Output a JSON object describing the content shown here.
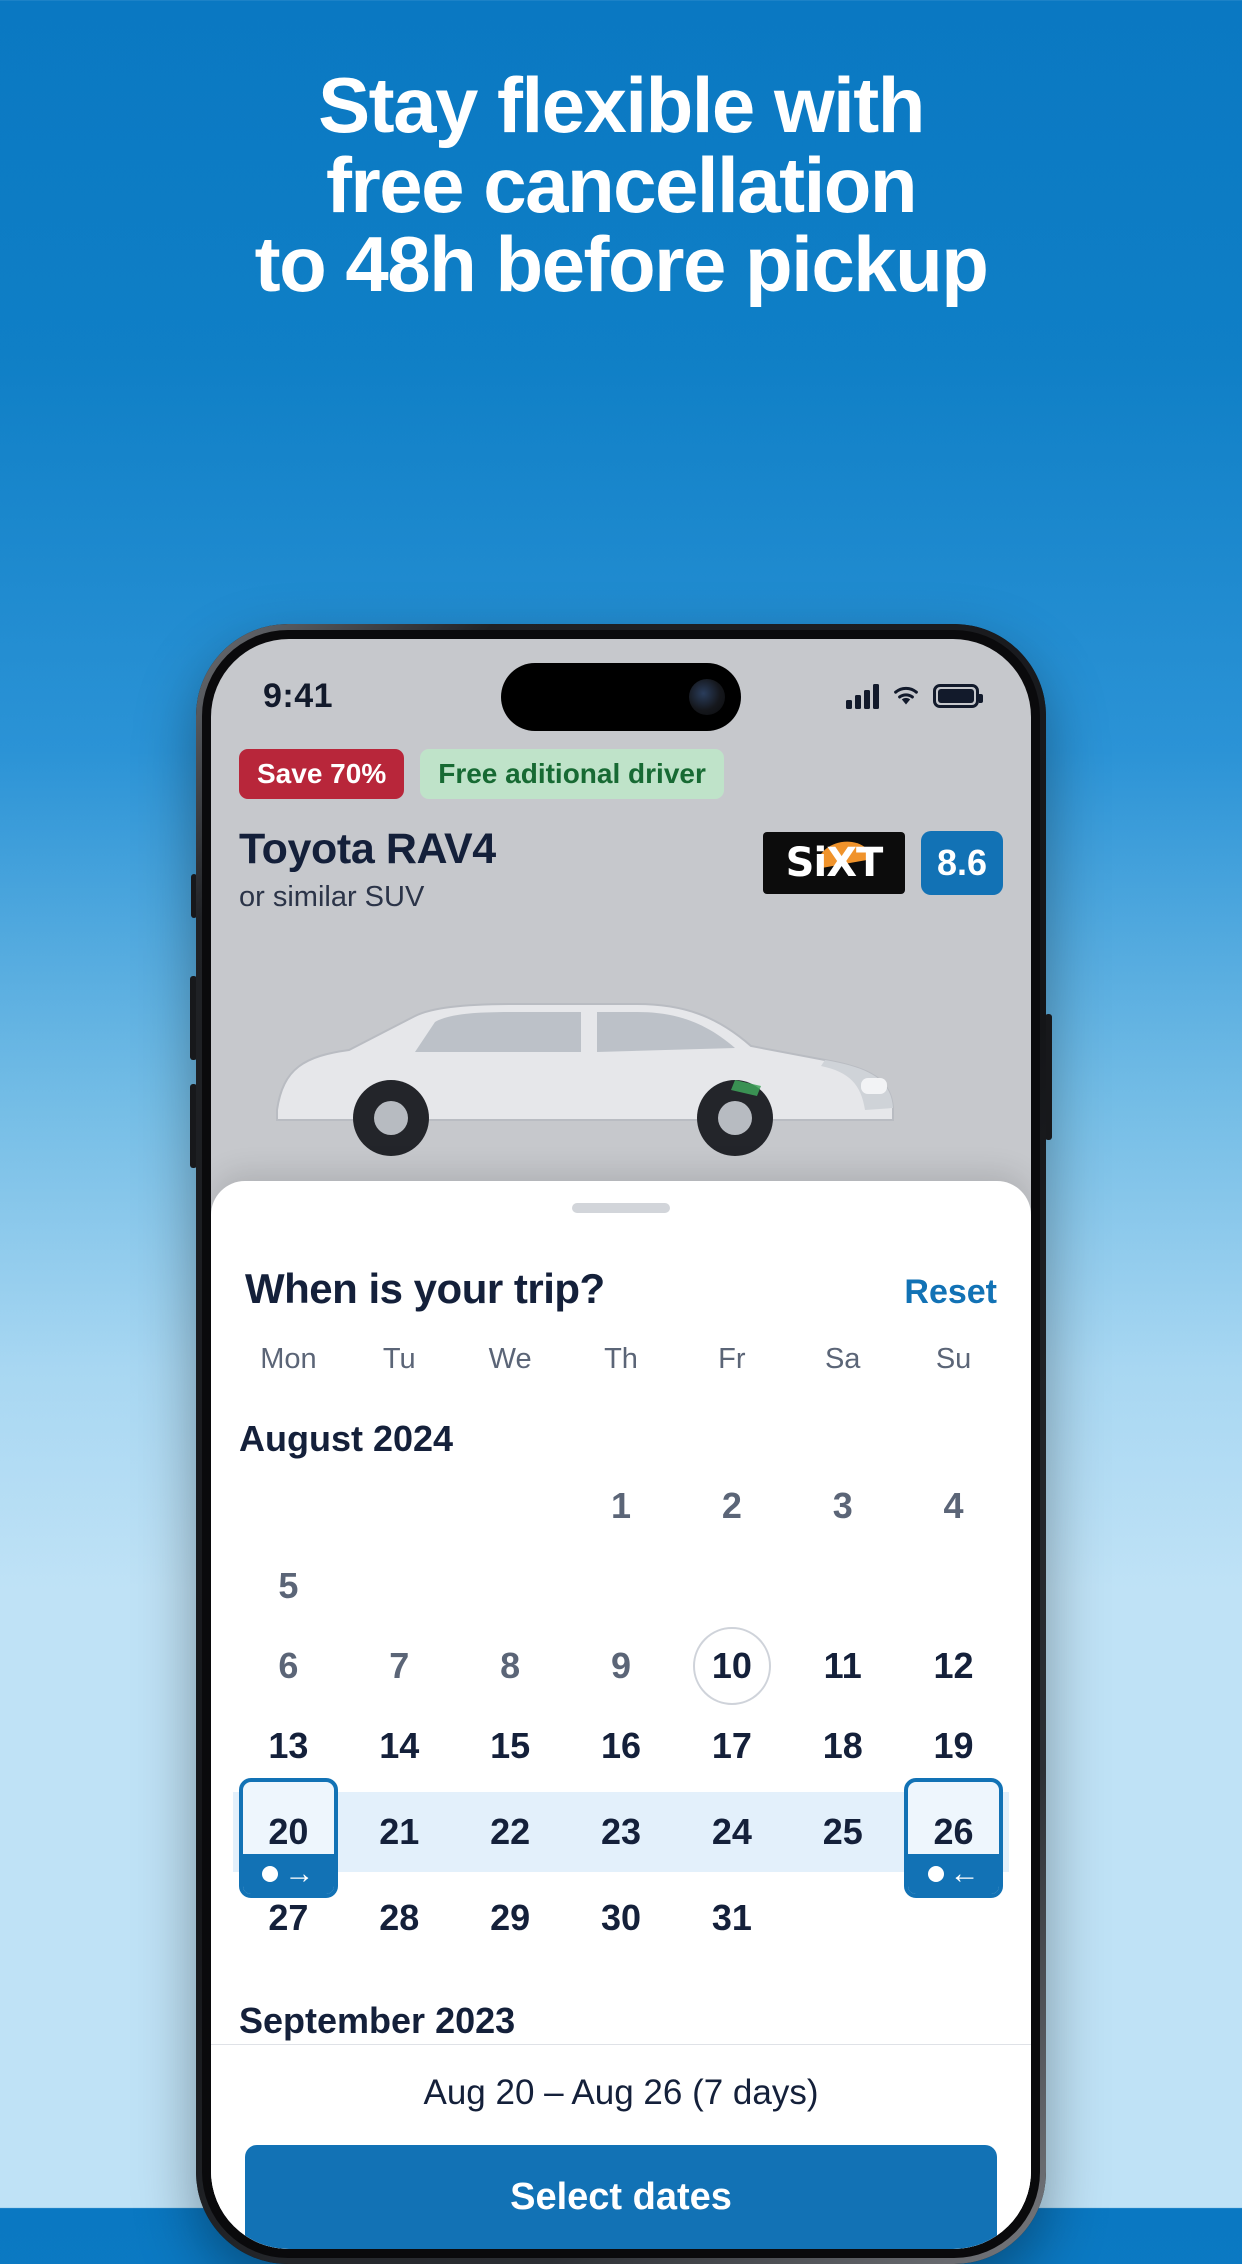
{
  "hero": {
    "headline_lines": [
      "Stay flexible with",
      "free cancellation",
      "to 48h before pickup"
    ],
    "background_top_color": "#0a78c2",
    "background_bottom_color": "#bfe2f6"
  },
  "phone": {
    "status_bar": {
      "time": "9:41",
      "signal_icon": "cellular-bars-icon",
      "wifi_icon": "wifi-icon",
      "battery_icon": "battery-full-icon"
    }
  },
  "car_card": {
    "chips": [
      {
        "label": "Save 70%",
        "style": "discount",
        "color": "#b8263a"
      },
      {
        "label": "Free aditional driver",
        "style": "perk",
        "color": "#bfe3c9"
      }
    ],
    "title": "Toyota RAV4",
    "subtitle": "or similar SUV",
    "supplier_logo_text": "SiXT",
    "rating": "8.6",
    "rating_color": "#1272b5"
  },
  "sheet": {
    "title": "When is your trip?",
    "reset_label": "Reset",
    "weekdays": [
      "Mon",
      "Tu",
      "We",
      "Th",
      "Fr",
      "Sa",
      "Su"
    ],
    "months": [
      {
        "label": "August 2024",
        "weeks": [
          [
            "",
            "",
            "",
            "1",
            "2",
            "3",
            "4"
          ],
          [
            "5",
            "6",
            "7",
            "8",
            "9",
            "10",
            "11"
          ],
          [
            "12",
            "13",
            "14",
            "15",
            "16",
            "17",
            "18"
          ],
          [
            "19",
            "20",
            "21",
            "22",
            "23",
            "24",
            "25"
          ],
          [
            "26",
            "27",
            "28",
            "29",
            "30",
            "31",
            ""
          ]
        ]
      },
      {
        "label": "September 2023",
        "weeks": []
      }
    ],
    "grid_rows": [
      {
        "cells": [
          "",
          "",
          "",
          "1",
          "2",
          "3",
          "4",
          "5"
        ]
      }
    ],
    "displayed_rows": [
      [
        "",
        "",
        "",
        "1",
        "2",
        "3",
        "4",
        "5"
      ]
    ],
    "calendar_rows": [
      {
        "days": [
          "",
          "",
          "",
          "1",
          "2",
          "3",
          "4",
          "5"
        ],
        "kind": "plain"
      }
    ],
    "rows": [
      {
        "kind": "plain",
        "days": [
          {
            "n": "",
            "state": "empty"
          },
          {
            "n": "",
            "state": "empty"
          },
          {
            "n": "",
            "state": "empty"
          },
          {
            "n": "1",
            "state": "muted"
          },
          {
            "n": "2",
            "state": "muted"
          },
          {
            "n": "3",
            "state": "muted"
          },
          {
            "n": "4",
            "state": "muted"
          },
          {
            "n": "5",
            "state": "muted"
          }
        ]
      },
      {
        "kind": "plain",
        "days": [
          {
            "n": "6",
            "state": "muted"
          },
          {
            "n": "7",
            "state": "muted"
          },
          {
            "n": "8",
            "state": "muted"
          },
          {
            "n": "9",
            "state": "muted"
          },
          {
            "n": "10",
            "state": "today"
          },
          {
            "n": "11",
            "state": "normal"
          },
          {
            "n": "12",
            "state": "normal"
          }
        ]
      },
      {
        "kind": "plain",
        "days": [
          {
            "n": "13",
            "state": "normal"
          },
          {
            "n": "14",
            "state": "normal"
          },
          {
            "n": "15",
            "state": "normal"
          },
          {
            "n": "16",
            "state": "normal"
          },
          {
            "n": "17",
            "state": "normal"
          },
          {
            "n": "18",
            "state": "normal"
          },
          {
            "n": "19",
            "state": "normal"
          }
        ]
      },
      {
        "kind": "range",
        "days": [
          {
            "n": "20",
            "state": "start"
          },
          {
            "n": "21",
            "state": "in"
          },
          {
            "n": "22",
            "state": "in"
          },
          {
            "n": "23",
            "state": "in"
          },
          {
            "n": "24",
            "state": "in"
          },
          {
            "n": "25",
            "state": "in"
          },
          {
            "n": "26",
            "state": "end"
          }
        ]
      },
      {
        "kind": "plain",
        "days": [
          {
            "n": "27",
            "state": "normal"
          },
          {
            "n": "28",
            "state": "normal"
          },
          {
            "n": "29",
            "state": "normal"
          },
          {
            "n": "30",
            "state": "normal"
          },
          {
            "n": "31",
            "state": "normal"
          },
          {
            "n": "",
            "state": "empty"
          },
          {
            "n": "",
            "state": "empty"
          }
        ]
      }
    ],
    "month_label": "August 2024",
    "next_month_label": "September 2023",
    "range_start_icon": "pickup-arrow-right-icon",
    "range_end_icon": "dropoff-arrow-left-icon",
    "summary": "Aug 20 – Aug 26 (7 days)",
    "cta_label": "Select dates",
    "accent_color": "#1272b5",
    "range_band_color": "#e3f0fb"
  }
}
